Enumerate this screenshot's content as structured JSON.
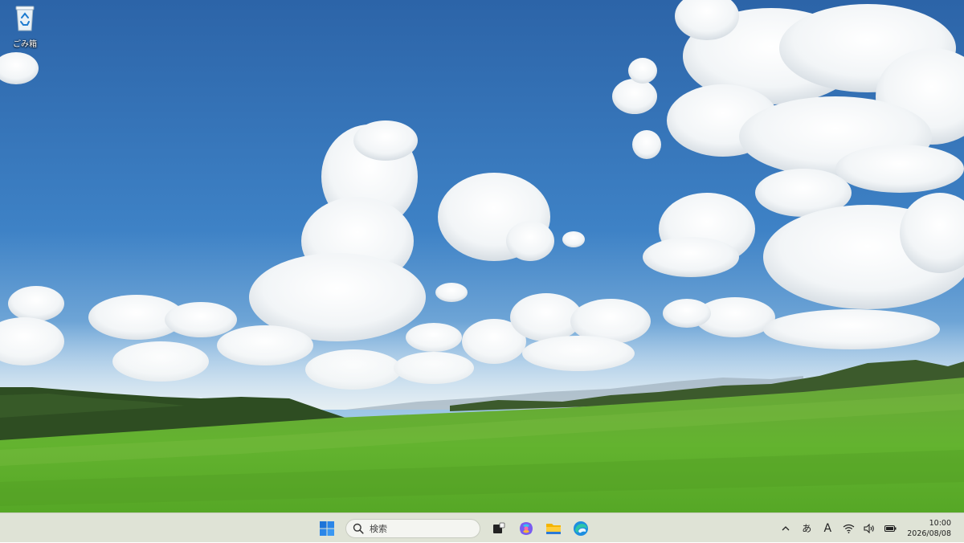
{
  "desktop": {
    "icons": [
      {
        "label": "ごみ箱",
        "icon": "recycle-bin-icon"
      }
    ]
  },
  "taskbar": {
    "start_icon": "windows-logo-icon",
    "search": {
      "icon": "search-icon",
      "placeholder": "検索"
    },
    "pinned": [
      {
        "icon": "task-view-icon"
      },
      {
        "icon": "copilot-icon"
      },
      {
        "icon": "file-explorer-icon"
      },
      {
        "icon": "edge-browser-icon"
      }
    ],
    "tray": {
      "overflow_icon": "chevron-up-icon",
      "ime_mode": "あ",
      "ime_indicator": "A",
      "wifi_icon": "wifi-icon",
      "volume_icon": "volume-icon",
      "battery_icon": "battery-icon",
      "time": "10:00",
      "date": "2026/08/08"
    }
  },
  "colors": {
    "taskbar_bg": "#dfe3d6",
    "sky_top": "#2f6fb3",
    "field": "#5fae2c",
    "windows_blue": "#1a73e8"
  }
}
